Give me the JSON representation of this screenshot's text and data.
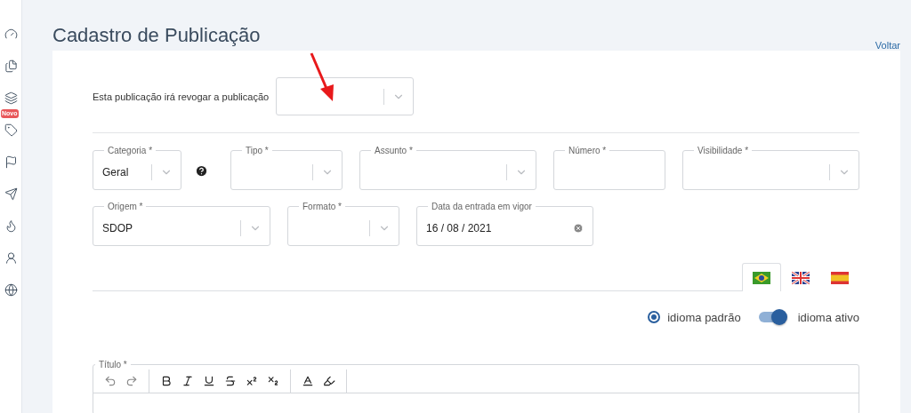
{
  "sidebar": {
    "badge": "Novo"
  },
  "page": {
    "title": "Cadastro de Publicação",
    "back_link": "Voltar"
  },
  "revoke": {
    "label": "Esta publicação irá revogar a publicação"
  },
  "field_rows": [
    [
      {
        "kind": "select",
        "label": "Categoria *",
        "value": "Geral"
      },
      {
        "kind": "help"
      },
      {
        "kind": "select",
        "label": "Tipo *"
      },
      {
        "kind": "select",
        "label": "Assunto *"
      },
      {
        "kind": "text",
        "label": "Número *"
      },
      {
        "kind": "select",
        "label": "Visibilidade *"
      }
    ],
    [
      {
        "kind": "select",
        "label": "Origem *",
        "value": "SDOP"
      },
      {
        "kind": "select",
        "label": "Formato *"
      },
      {
        "kind": "date",
        "label": "Data da entrada em vigor",
        "value": "16 / 08 / 2021"
      }
    ]
  ],
  "language_tabs": [
    {
      "kind": "br",
      "selected": true
    },
    {
      "kind": "gb",
      "selected": false
    },
    {
      "kind": "es",
      "selected": false
    }
  ],
  "options": {
    "default_language": {
      "label": "idioma padrão",
      "checked": true
    },
    "active_language": {
      "label": "idioma ativo",
      "on": true
    }
  },
  "editor": {
    "label": "Título *"
  }
}
